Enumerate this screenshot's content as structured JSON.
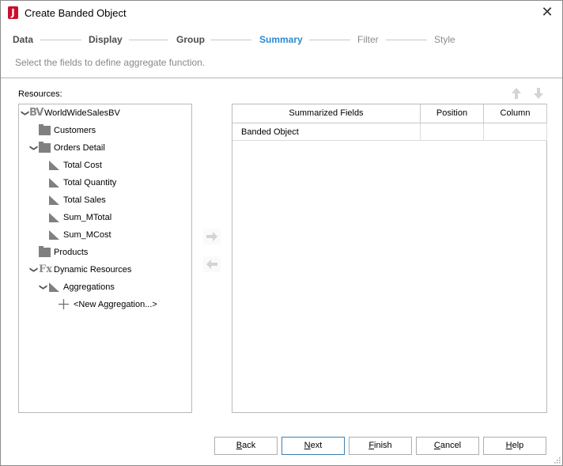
{
  "window": {
    "title": "Create Banded Object",
    "app_icon_letter": "J",
    "close_glyph": "✕"
  },
  "wizard": {
    "steps": [
      {
        "label": "Data",
        "state": "done"
      },
      {
        "label": "Display",
        "state": "done"
      },
      {
        "label": "Group",
        "state": "done"
      },
      {
        "label": "Summary",
        "state": "active"
      },
      {
        "label": "Filter",
        "state": "future"
      },
      {
        "label": "Style",
        "state": "future"
      }
    ],
    "subtitle": "Select the fields to define aggregate function."
  },
  "resources": {
    "label": "Resources:",
    "tree": [
      {
        "label": "WorldWideSalesBV",
        "icon": "bv-icon",
        "expanded": true
      },
      {
        "label": "Customers",
        "icon": "folder-icon"
      },
      {
        "label": "Orders Detail",
        "icon": "folder-icon",
        "expanded": true
      },
      {
        "label": "Total Cost",
        "icon": "measure-icon"
      },
      {
        "label": "Total Quantity",
        "icon": "measure-icon"
      },
      {
        "label": "Total Sales",
        "icon": "measure-icon"
      },
      {
        "label": "Sum_MTotal",
        "icon": "measure-icon"
      },
      {
        "label": "Sum_MCost",
        "icon": "measure-icon"
      },
      {
        "label": "Products",
        "icon": "folder-icon"
      },
      {
        "label": "Dynamic Resources",
        "icon": "fx-icon",
        "expanded": true
      },
      {
        "label": "Aggregations",
        "icon": "measure-icon",
        "expanded": true
      },
      {
        "label": "<New Aggregation...>",
        "icon": "plus-icon"
      }
    ]
  },
  "bv_glyph": "BV",
  "fx_glyph": "Fx",
  "expand_glyph": "❯",
  "summary": {
    "columns": [
      "Summarized Fields",
      "Position",
      "Column"
    ],
    "rows": [
      {
        "field": "Banded Object",
        "position": "",
        "column": ""
      }
    ]
  },
  "buttons": {
    "back": {
      "label": "Back",
      "mnemonic": "B"
    },
    "next": {
      "label": "Next",
      "mnemonic": "N"
    },
    "finish": {
      "label": "Finish",
      "mnemonic": "F"
    },
    "cancel": {
      "label": "Cancel",
      "mnemonic": "C"
    },
    "help": {
      "label": "Help",
      "mnemonic": "H"
    }
  },
  "colors": {
    "active_step": "#2a8bd3",
    "icon_gray": "#808080",
    "disabled_arrow": "#d0d0d0"
  }
}
